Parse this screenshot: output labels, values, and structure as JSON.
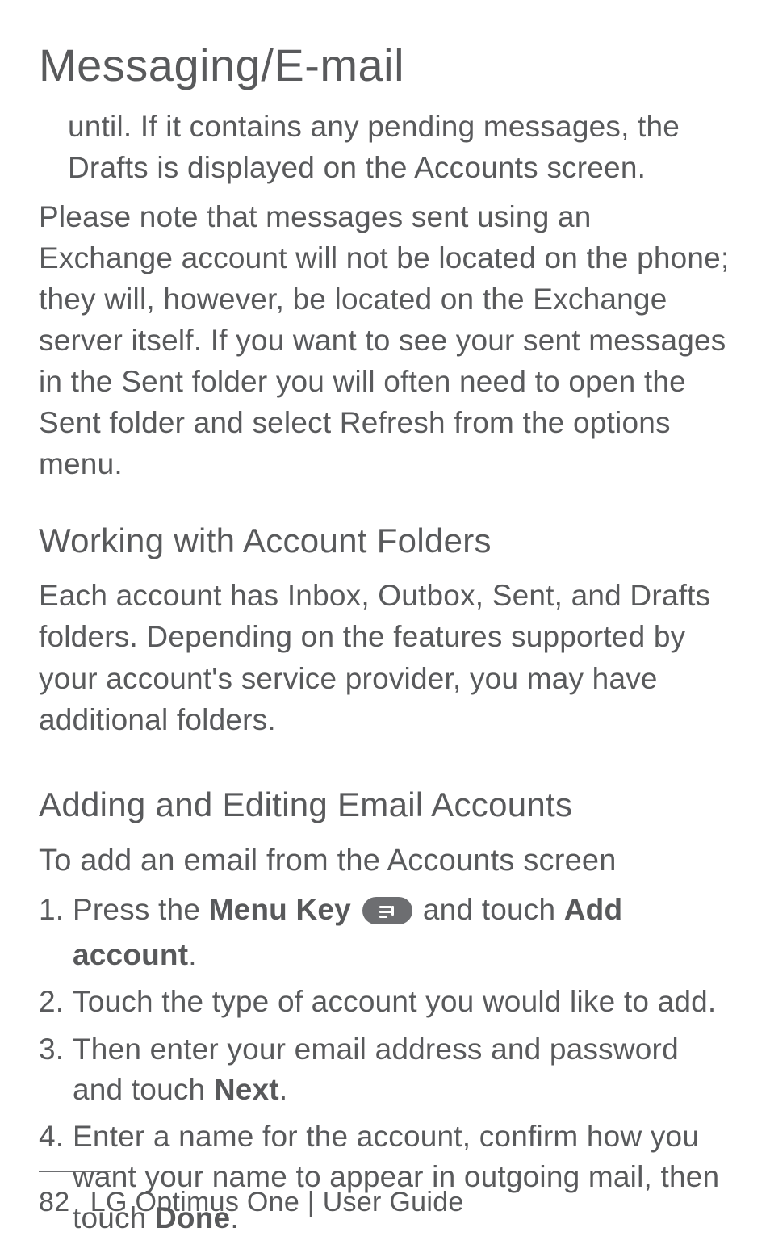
{
  "title": "Messaging/E-mail",
  "intro_hanging": "until. If it contains any pending messages, the Drafts is displayed on the Accounts screen.",
  "intro_main": "Please note that messages sent using an Exchange account will not be located on the phone; they will, however, be located on the Exchange server itself. If you want to see your sent messages in the Sent folder you will often need to open the Sent folder and select Refresh from the options menu.",
  "sections": {
    "folders": {
      "heading": "Working with Account Folders",
      "body": "Each account has Inbox, Outbox, Sent, and Drafts folders. Depending on the features supported by your account's service provider, you may have additional folders."
    },
    "accounts": {
      "heading": "Adding and Editing Email Accounts",
      "subheading": "To add an email from the Accounts screen",
      "steps": {
        "s1": {
          "pre": "Press the ",
          "menu_key": "Menu Key",
          "mid": " and touch ",
          "add_account": "Add account",
          "post": "."
        },
        "s2": "Touch the type of account you would like to add.",
        "s3": {
          "pre": "Then enter your email address and password and touch ",
          "next": "Next",
          "post": "."
        },
        "s4": {
          "pre": "Enter a name for the account, confirm how you want your name to appear in outgoing mail, then touch ",
          "done": "Done",
          "post": "."
        }
      }
    }
  },
  "footer": {
    "page_number": "82",
    "product": "LG Optimus One",
    "separator": "  |  ",
    "guide": "User Guide"
  },
  "icons": {
    "menu_key": "menu-key-icon"
  }
}
